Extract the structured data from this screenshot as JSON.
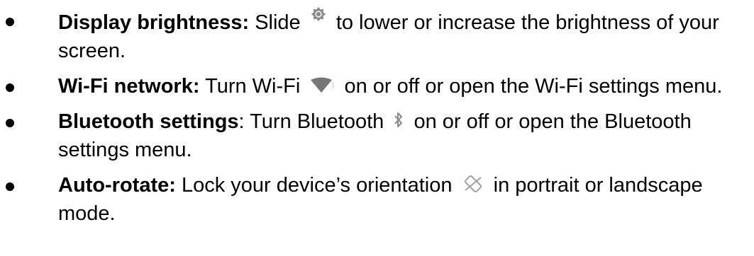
{
  "items": [
    {
      "term": "Display brightness:",
      "text_before_icon": "Slide",
      "icon": "brightness-icon",
      "text_after_icon": "to lower or increase the brightness of your screen."
    },
    {
      "term": "Wi-Fi network:",
      "text_before_icon": "Turn Wi-Fi",
      "icon": "wifi-icon",
      "text_after_icon": "on or off or open the Wi-Fi settings menu."
    },
    {
      "term": "Bluetooth settings",
      "term_suffix": ":",
      "text_before_icon": "Turn Bluetooth",
      "icon": "bluetooth-icon",
      "text_after_icon": "on or off or open the Bluetooth settings menu."
    },
    {
      "term": "Auto-rotate:",
      "text_before_icon": "Lock your device’s orientation",
      "icon": "auto-rotate-icon",
      "text_after_icon": "in portrait or landscape mode."
    }
  ],
  "colors": {
    "text": "#000000",
    "icon": "#8a8a8a"
  }
}
